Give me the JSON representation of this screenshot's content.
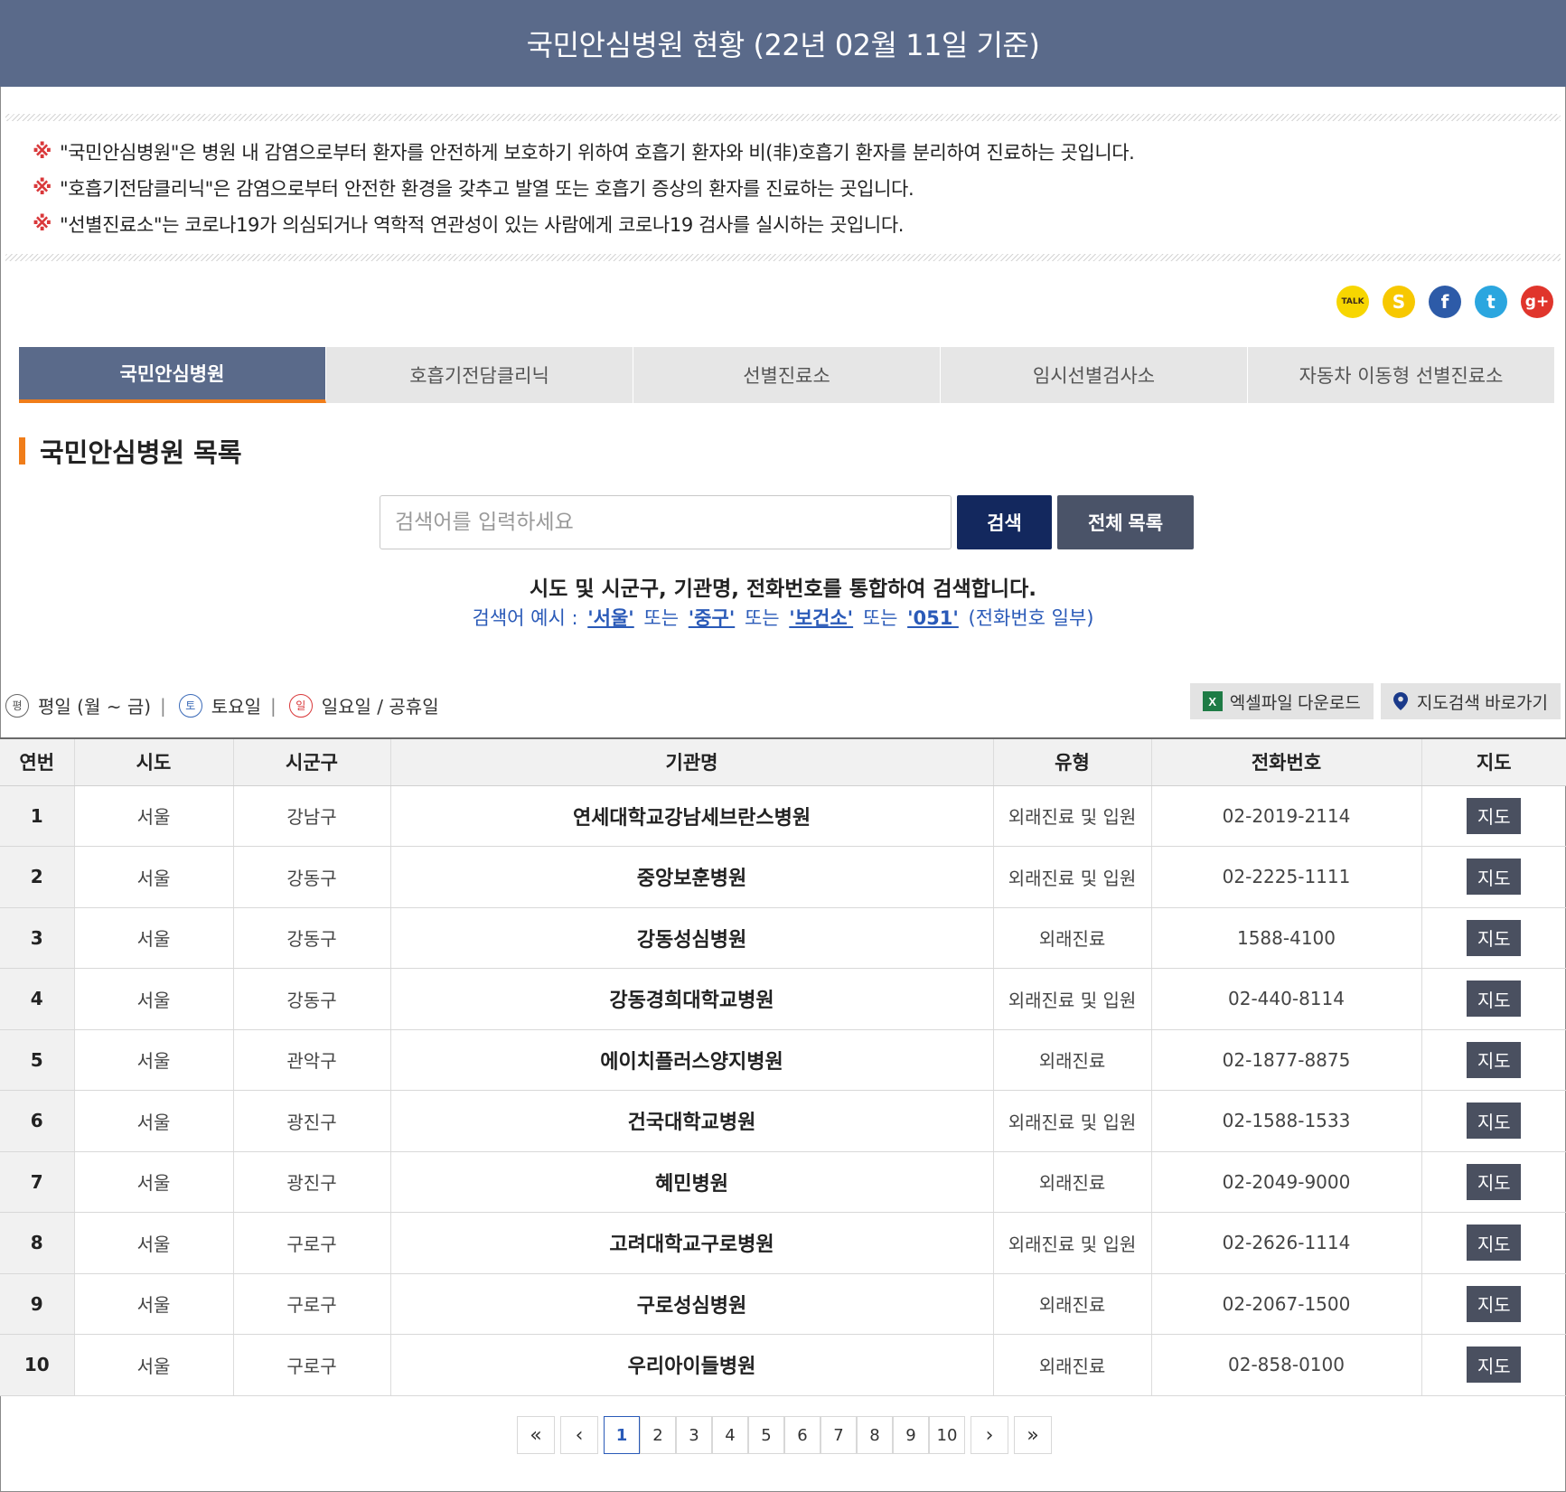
{
  "header": {
    "title": "국민안심병원 현황 (22년 02월 11일 기준)"
  },
  "notices": [
    {
      "mark": "※",
      "text": "\"국민안심병원\"은 병원 내 감염으로부터 환자를 안전하게 보호하기 위하여 호흡기 환자와 비(非)호흡기 환자를 분리하여 진료하는 곳입니다."
    },
    {
      "mark": "※",
      "text": "\"호흡기전담클리닉\"은 감염으로부터 안전한 환경을 갖추고 발열 또는 호흡기 증상의 환자를 진료하는 곳입니다."
    },
    {
      "mark": "※",
      "text": "\"선별진료소\"는 코로나19가 의심되거나 역학적 연관성이 있는 사람에게 코로나19 검사를 실시하는 곳입니다."
    }
  ],
  "share": {
    "kakao_label": "TALK",
    "story_label": "S",
    "fb_label": "f",
    "tw_label": "t",
    "gp_label": "g+"
  },
  "tabs": [
    {
      "label": "국민안심병원"
    },
    {
      "label": "호흡기전담클리닉"
    },
    {
      "label": "선별진료소"
    },
    {
      "label": "임시선별검사소"
    },
    {
      "label": "자동차 이동형 선별진료소"
    }
  ],
  "section": {
    "title": "국민안심병원 목록"
  },
  "search": {
    "placeholder": "검색어를 입력하세요",
    "search_label": "검색",
    "all_label": "전체 목록",
    "desc": "시도 및 시군구, 기관명, 전화번호를 통합하여 검색합니다.",
    "example_prefix": "검색어 예시 :",
    "ex1": "'서울'",
    "or1": "또는",
    "ex2": "'중구'",
    "or2": "또는",
    "ex3": "'보건소'",
    "or3": "또는",
    "ex4": "'051'",
    "example_suffix": "(전화번호 일부)"
  },
  "legend": {
    "week_icon": "평",
    "week_label": "평일 (월 ~ 금)",
    "sat_icon": "토",
    "sat_label": "토요일",
    "sun_icon": "일",
    "sun_label": "일요일 / 공휴일",
    "sep": "|"
  },
  "actions": {
    "excel_label": "엑셀파일 다운로드",
    "excel_icon": "X",
    "map_search_label": "지도검색 바로가기"
  },
  "table": {
    "headers": [
      "연번",
      "시도",
      "시군구",
      "기관명",
      "유형",
      "전화번호",
      "지도"
    ],
    "map_label": "지도",
    "rows": [
      {
        "no": "1",
        "sido": "서울",
        "sigungu": "강남구",
        "name": "연세대학교강남세브란스병원",
        "type": "외래진료 및 입원",
        "phone": "02-2019-2114"
      },
      {
        "no": "2",
        "sido": "서울",
        "sigungu": "강동구",
        "name": "중앙보훈병원",
        "type": "외래진료 및 입원",
        "phone": "02-2225-1111"
      },
      {
        "no": "3",
        "sido": "서울",
        "sigungu": "강동구",
        "name": "강동성심병원",
        "type": "외래진료",
        "phone": "1588-4100"
      },
      {
        "no": "4",
        "sido": "서울",
        "sigungu": "강동구",
        "name": "강동경희대학교병원",
        "type": "외래진료 및 입원",
        "phone": "02-440-8114"
      },
      {
        "no": "5",
        "sido": "서울",
        "sigungu": "관악구",
        "name": "에이치플러스양지병원",
        "type": "외래진료",
        "phone": "02-1877-8875"
      },
      {
        "no": "6",
        "sido": "서울",
        "sigungu": "광진구",
        "name": "건국대학교병원",
        "type": "외래진료 및 입원",
        "phone": "02-1588-1533"
      },
      {
        "no": "7",
        "sido": "서울",
        "sigungu": "광진구",
        "name": "혜민병원",
        "type": "외래진료",
        "phone": "02-2049-9000"
      },
      {
        "no": "8",
        "sido": "서울",
        "sigungu": "구로구",
        "name": "고려대학교구로병원",
        "type": "외래진료 및 입원",
        "phone": "02-2626-1114"
      },
      {
        "no": "9",
        "sido": "서울",
        "sigungu": "구로구",
        "name": "구로성심병원",
        "type": "외래진료",
        "phone": "02-2067-1500"
      },
      {
        "no": "10",
        "sido": "서울",
        "sigungu": "구로구",
        "name": "우리아이들병원",
        "type": "외래진료",
        "phone": "02-858-0100"
      }
    ]
  },
  "pager": {
    "first": "«",
    "prev": "‹",
    "next": "›",
    "last": "»",
    "pages": [
      "1",
      "2",
      "3",
      "4",
      "5",
      "6",
      "7",
      "8",
      "9",
      "10"
    ],
    "current": "1"
  },
  "colors": {
    "header_bg": "#5a6a8a",
    "accent": "#f07d1a",
    "search_btn": "#13285e",
    "link": "#2a5ab8"
  }
}
